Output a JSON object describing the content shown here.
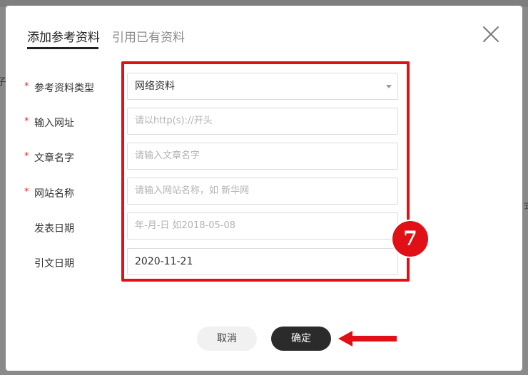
{
  "background": {
    "left_fragments": [
      "子"
    ],
    "right_fragments": [
      "式"
    ]
  },
  "tabs": [
    {
      "label": "添加参考资料",
      "active": true
    },
    {
      "label": "引用已有资料",
      "active": false
    }
  ],
  "form": {
    "fields": [
      {
        "label": "参考资料类型",
        "required": true,
        "value": "网络资料",
        "type": "select"
      },
      {
        "label": "输入网址",
        "required": true,
        "placeholder": "请以http(s)://开头"
      },
      {
        "label": "文章名字",
        "required": true,
        "placeholder": "请输入文章名字"
      },
      {
        "label": "网站名称",
        "required": true,
        "placeholder": "请输入网站名称，如 新华网"
      },
      {
        "label": "发表日期",
        "required": false,
        "placeholder": "年-月-日 如2018-05-08"
      },
      {
        "label": "引文日期",
        "required": false,
        "value": "2020-11-21"
      }
    ],
    "required_mark": "*"
  },
  "annotation": {
    "step_number": "7",
    "highlight_color": "#e01016"
  },
  "buttons": {
    "cancel": "取消",
    "confirm": "确定"
  },
  "icons": {
    "close": "close-icon",
    "arrow": "arrow-left-icon",
    "dropdown": "chevron-down-icon"
  }
}
